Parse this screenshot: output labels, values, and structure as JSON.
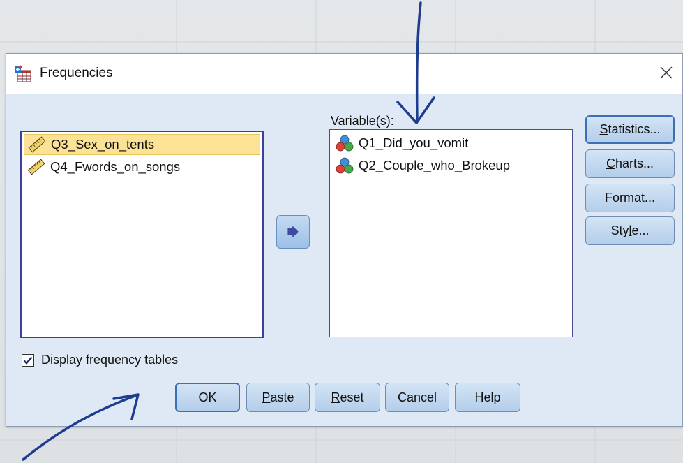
{
  "window": {
    "title": "Frequencies",
    "close_symbol": "✕"
  },
  "source_list": {
    "items": [
      {
        "label": "Q3_Sex_on_tents",
        "icon": "ruler-icon",
        "selected": true
      },
      {
        "label": "Q4_Fwords_on_songs",
        "icon": "ruler-icon",
        "selected": false
      }
    ]
  },
  "target_list": {
    "label_prefix": "V",
    "label_rest": "ariable(s):",
    "items": [
      {
        "label": "Q1_Did_you_vomit",
        "icon": "nominal-variable-icon"
      },
      {
        "label": "Q2_Couple_who_Brokeup",
        "icon": "nominal-variable-icon"
      }
    ]
  },
  "side_buttons": {
    "statistics": {
      "ul": "S",
      "rest": "tatistics..."
    },
    "charts": {
      "ul": "C",
      "rest": "harts..."
    },
    "format": {
      "ul": "F",
      "rest": "ormat..."
    },
    "style": {
      "pre": "Sty",
      "ul": "l",
      "rest": "e..."
    }
  },
  "checkbox": {
    "ul": "D",
    "rest": "isplay frequency tables",
    "checked": true
  },
  "bottom_buttons": {
    "ok": "OK",
    "paste": {
      "ul": "P",
      "rest": "aste"
    },
    "reset": {
      "ul": "R",
      "rest": "eset"
    },
    "cancel": "Cancel",
    "help": "Help"
  },
  "colors": {
    "dialog_bg": "#dfe9f5",
    "selection": "#fbe295",
    "list_border": "#3d3f9a",
    "annotation": "#1f3d8f"
  }
}
